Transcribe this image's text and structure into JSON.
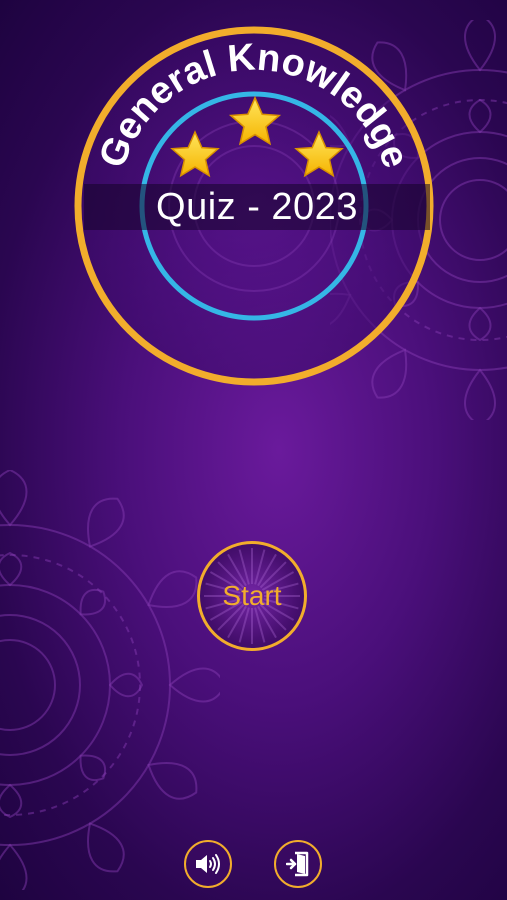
{
  "app": {
    "title_arc": "General Knowledge",
    "subtitle": "Quiz - 2023"
  },
  "actions": {
    "start_label": "Start"
  },
  "icons": {
    "sound": "speaker-volume-icon",
    "exit": "exit-door-icon",
    "stars": "star-icon"
  },
  "colors": {
    "background": "#4a0f7a",
    "accent_gold": "#f2ad2c",
    "inner_ring_blue": "#35b6e6",
    "star_yellow": "#ffcc1a",
    "text_white": "#ffffff"
  }
}
